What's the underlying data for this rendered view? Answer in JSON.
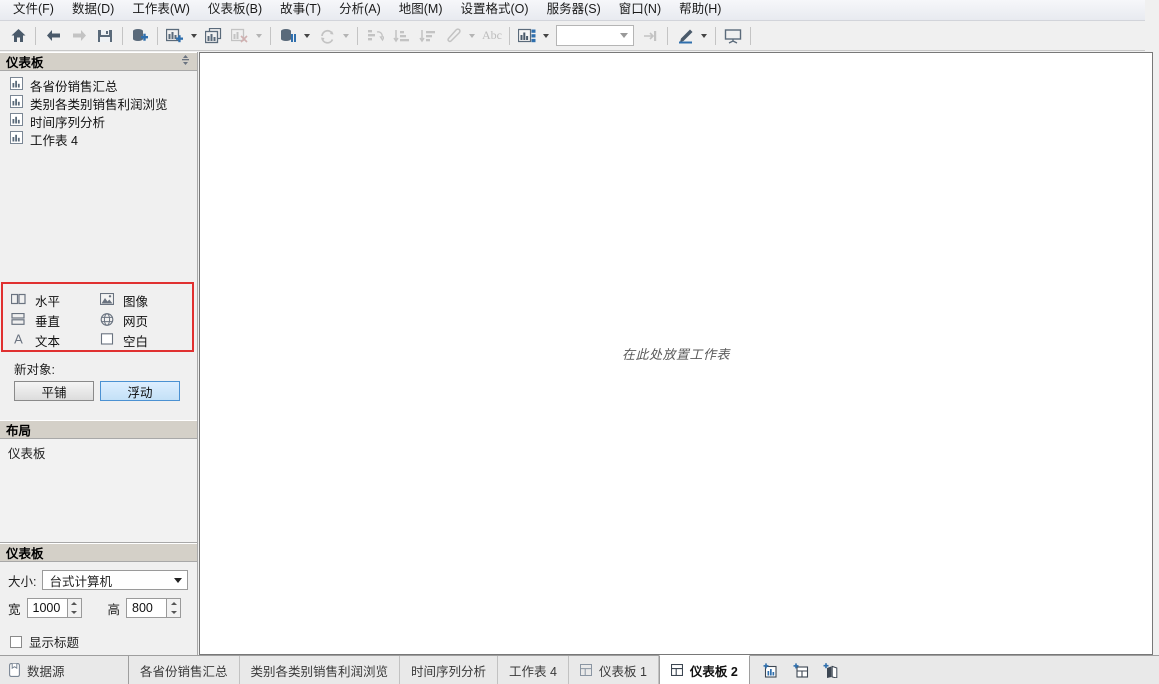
{
  "menubar": {
    "items": [
      {
        "label": "文件(F)",
        "key": "F"
      },
      {
        "label": "数据(D)",
        "key": "D"
      },
      {
        "label": "工作表(W)",
        "key": "W"
      },
      {
        "label": "仪表板(B)",
        "key": "B"
      },
      {
        "label": "故事(T)",
        "key": "T"
      },
      {
        "label": "分析(A)",
        "key": "A"
      },
      {
        "label": "地图(M)",
        "key": "M"
      },
      {
        "label": "设置格式(O)",
        "key": "O"
      },
      {
        "label": "服务器(S)",
        "key": "S"
      },
      {
        "label": "窗口(N)",
        "key": "N"
      },
      {
        "label": "帮助(H)",
        "key": "H"
      }
    ]
  },
  "toolbar": {
    "buttons": [
      {
        "name": "home-icon",
        "title": "开始页面"
      },
      {
        "name": "back-arrow-icon",
        "title": "撤消"
      },
      {
        "name": "forward-arrow-icon",
        "title": "重做"
      },
      {
        "name": "save-icon",
        "title": "保存"
      },
      {
        "name": "new-data-source-icon",
        "title": "新建数据源"
      },
      {
        "name": "new-worksheet-icon",
        "title": "新建工作表"
      },
      {
        "name": "duplicate-sheet-icon",
        "title": "复制工作表"
      },
      {
        "name": "clear-sheet-icon",
        "title": "清除工作表"
      },
      {
        "name": "refresh-data-icon",
        "title": "刷新数据源"
      },
      {
        "name": "pause-updates-icon",
        "title": "自动更新"
      },
      {
        "name": "swap-rows-columns-icon",
        "title": "交换行和列"
      },
      {
        "name": "sort-ascending-icon",
        "title": "升序排序"
      },
      {
        "name": "sort-descending-icon",
        "title": "降序排序"
      },
      {
        "name": "highlight-icon",
        "title": "突出显示"
      },
      {
        "name": "labels-icon",
        "title": "标签"
      },
      {
        "name": "show-me-icon",
        "title": "智能显示"
      },
      {
        "name": "fit-dropdown",
        "title": "适合"
      },
      {
        "name": "fix-axes-icon",
        "title": "固定轴"
      },
      {
        "name": "format-icon",
        "title": "设置格式"
      },
      {
        "name": "presentation-mode-icon",
        "title": "演示模式"
      }
    ],
    "fit_value": ""
  },
  "sidebar": {
    "dashboard_panel": {
      "title": "仪表板",
      "sort_icon": "sort-updown-icon",
      "sheets": [
        {
          "label": "各省份销售汇总",
          "icon": "worksheet-icon"
        },
        {
          "label": "类别各类别销售利润浏览",
          "icon": "worksheet-icon"
        },
        {
          "label": "时间序列分析",
          "icon": "worksheet-icon"
        },
        {
          "label": "工作表 4",
          "icon": "worksheet-icon"
        }
      ]
    },
    "objects": {
      "highlighted": true,
      "highlight_color": "#e03030",
      "column_left": [
        {
          "label": "水平",
          "icon": "horizontal-container-icon"
        },
        {
          "label": "垂直",
          "icon": "vertical-container-icon"
        },
        {
          "label": "文本",
          "icon": "text-object-icon"
        }
      ],
      "column_right": [
        {
          "label": "图像",
          "icon": "image-object-icon"
        },
        {
          "label": "网页",
          "icon": "webpage-object-icon"
        },
        {
          "label": "空白",
          "icon": "blank-object-icon"
        }
      ]
    },
    "new_object": {
      "label": "新对象:",
      "tiled_label": "平铺",
      "floating_label": "浮动",
      "selected": "浮动"
    },
    "layout_panel": {
      "title": "布局",
      "tree_item": "仪表板"
    },
    "size_panel": {
      "title": "仪表板",
      "size_label": "大小:",
      "size_value": "台式计算机",
      "width_label": "宽",
      "width_value": "1000",
      "height_label": "高",
      "height_value": "800",
      "show_title_label": "显示标题",
      "show_title_checked": false
    }
  },
  "canvas": {
    "drop_hint": "在此处放置工作表"
  },
  "tabbar": {
    "datasource": {
      "label": "数据源",
      "icon": "datasource-icon"
    },
    "tabs": [
      {
        "label": "各省份销售汇总",
        "icon": null,
        "active": false
      },
      {
        "label": "类别各类别销售利润浏览",
        "icon": null,
        "active": false
      },
      {
        "label": "时间序列分析",
        "icon": null,
        "active": false
      },
      {
        "label": "工作表 4",
        "icon": null,
        "active": false
      },
      {
        "label": "仪表板 1",
        "icon": "dashboard-icon",
        "active": false
      },
      {
        "label": "仪表板 2",
        "icon": "dashboard-icon",
        "active": true
      }
    ],
    "new_buttons": [
      {
        "name": "new-worksheet-icon",
        "title": "新建工作表"
      },
      {
        "name": "new-dashboard-icon",
        "title": "新建仪表板"
      },
      {
        "name": "new-story-icon",
        "title": "新建故事"
      }
    ]
  }
}
